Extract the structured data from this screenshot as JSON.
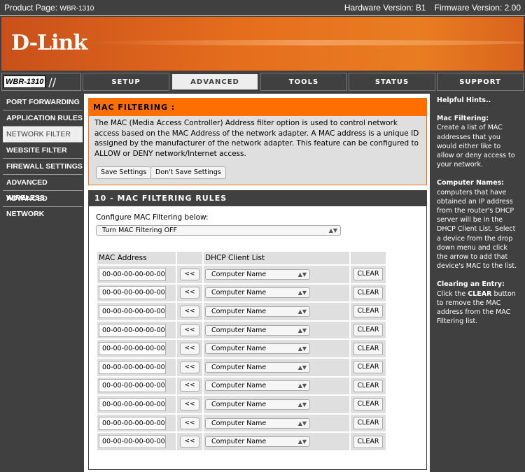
{
  "topbar": {
    "product_label": "Product Page:",
    "product": "WBR-1310",
    "hardware": "Hardware Version: B1",
    "firmware": "Firmware Version: 2.00"
  },
  "brand": {
    "logo": "D-Link",
    "model": "WBR-1310"
  },
  "nav": {
    "tabs": [
      "SETUP",
      "ADVANCED",
      "TOOLS",
      "STATUS",
      "SUPPORT"
    ],
    "active": "ADVANCED"
  },
  "sidebar": {
    "items": [
      "PORT FORWARDING",
      "APPLICATION RULES",
      "NETWORK FILTER",
      "WEBSITE FILTER",
      "FIREWALL SETTINGS",
      "ADVANCED WIRELESS",
      "ADVANCED NETWORK"
    ],
    "active": "NETWORK FILTER"
  },
  "mac_filtering": {
    "title": "MAC FILTERING :",
    "description": "The MAC (Media Access Controller) Address filter option is used to control network access based on the MAC Address of the network adapter. A MAC address is a unique ID assigned by the manufacturer of the network adapter. This feature can be configured to ALLOW or DENY network/Internet access.",
    "save_label": "Save Settings",
    "dont_save_label": "Don't Save Settings"
  },
  "rules": {
    "title": "10 - MAC FILTERING RULES",
    "configure_label": "Configure MAC Filtering below:",
    "configure_value": "Turn MAC Filtering OFF",
    "headers": {
      "mac": "MAC Address",
      "dhcp": "DHCP Client List"
    },
    "copy_label": "<<",
    "clear_label": "CLEAR",
    "rows": [
      {
        "mac": "00-00-00-00-00-00",
        "client": "Computer Name"
      },
      {
        "mac": "00-00-00-00-00-00",
        "client": "Computer Name"
      },
      {
        "mac": "00-00-00-00-00-00",
        "client": "Computer Name"
      },
      {
        "mac": "00-00-00-00-00-00",
        "client": "Computer Name"
      },
      {
        "mac": "00-00-00-00-00-00",
        "client": "Computer Name"
      },
      {
        "mac": "00-00-00-00-00-00",
        "client": "Computer Name"
      },
      {
        "mac": "00-00-00-00-00-00",
        "client": "Computer Name"
      },
      {
        "mac": "00-00-00-00-00-00",
        "client": "Computer Name"
      },
      {
        "mac": "00-00-00-00-00-00",
        "client": "Computer Name"
      },
      {
        "mac": "00-00-00-00-00-00",
        "client": "Computer Name"
      }
    ]
  },
  "hints": {
    "title": "Helpful Hints..",
    "mac_title": "Mac Filtering:",
    "mac_text": "Create a list of MAC addresses that you would either like to allow or deny access to your network.",
    "names_title": "Computer Names:",
    "names_text": "computers that have obtained an IP address from the router's DHCP server will be in the DHCP Client List. Select a device from the drop down menu and click the arrow to add that device's MAC to the list.",
    "clear_title": "Clearing an Entry:",
    "clear_pre": "Click the ",
    "clear_bold": "CLEAR",
    "clear_post": " button to remove the MAC address from the MAC Filtering list."
  },
  "colors": {
    "accent": "#ff6f00",
    "dark": "#404040"
  }
}
